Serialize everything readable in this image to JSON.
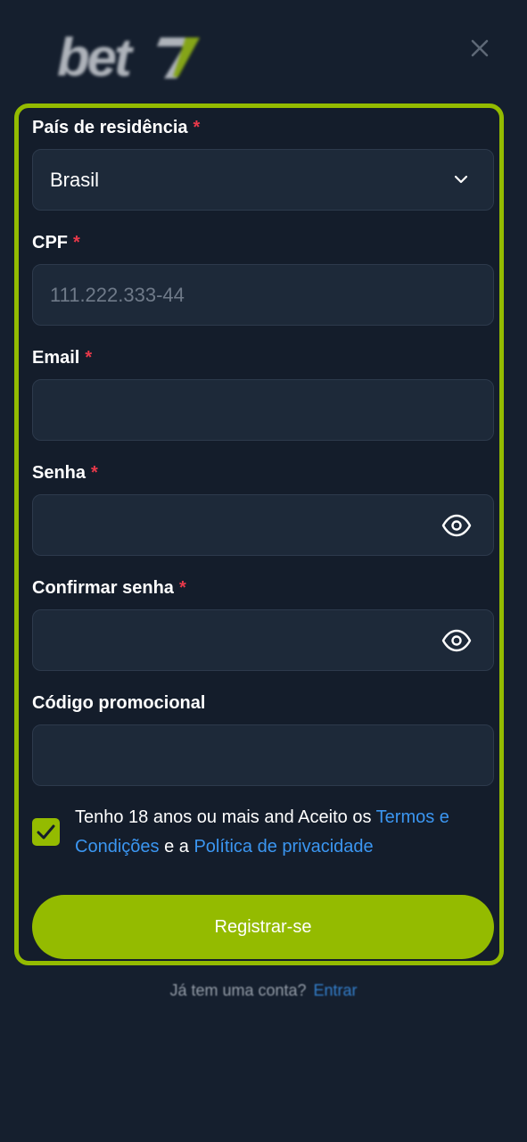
{
  "app": {
    "brand": "bet7"
  },
  "form": {
    "country": {
      "label": "País de residência",
      "required_mark": "*",
      "value": "Brasil"
    },
    "cpf": {
      "label": "CPF",
      "required_mark": "*",
      "placeholder": "111.222.333-44",
      "value": ""
    },
    "email": {
      "label": "Email",
      "required_mark": "*",
      "value": ""
    },
    "password": {
      "label": "Senha",
      "required_mark": "*",
      "value": ""
    },
    "confirm_password": {
      "label": "Confirmar senha",
      "required_mark": "*",
      "value": ""
    },
    "promo_code": {
      "label": "Código promocional",
      "value": ""
    },
    "terms": {
      "checked": true,
      "text_1": "Tenho 18 anos ou mais and Aceito os ",
      "link_terms": "Termos e Condições",
      "text_2": " e a ",
      "link_privacy": "Política de privacidade"
    },
    "submit_label": "Registrar-se"
  },
  "footer": {
    "question": "Já tem uma conta?",
    "login_link": "Entrar"
  },
  "icons": {
    "close": "close-icon",
    "chevron": "chevron-down-icon",
    "eye": "eye-icon",
    "check": "checkmark-icon"
  },
  "colors": {
    "background": "#151f2e",
    "accent": "#94bb00",
    "field_bg": "#1d2939",
    "link": "#3b96f1",
    "required": "#e8394a"
  }
}
